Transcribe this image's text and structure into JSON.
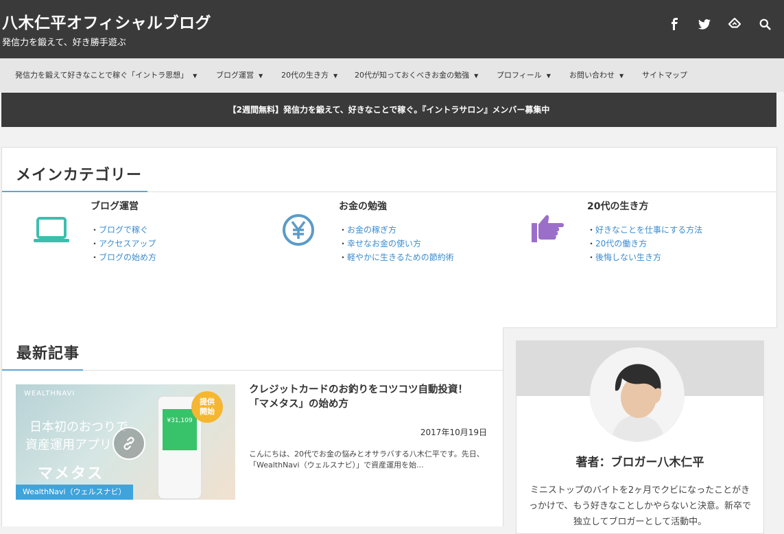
{
  "header": {
    "site_title": "八木仁平オフィシャルブログ",
    "tagline": "発信力を鍛えて、好き勝手遊ぶ",
    "icons": [
      "facebook-icon",
      "twitter-icon",
      "feedly-icon",
      "search-icon"
    ]
  },
  "nav": {
    "items": [
      {
        "label": "発信力を鍛えて好きなことで稼ぐ「イントラ思想」",
        "caret": "▼"
      },
      {
        "label": "ブログ運営",
        "caret": "▼"
      },
      {
        "label": "20代の生き方",
        "caret": "▼"
      },
      {
        "label": "20代が知っておくべきお金の勉強",
        "caret": "▼"
      },
      {
        "label": "プロフィール",
        "caret": "▼"
      },
      {
        "label": "お問い合わせ",
        "caret": "▼"
      },
      {
        "label": "サイトマップ",
        "caret": ""
      }
    ]
  },
  "banner": {
    "text": "【2週間無料】発信力を鍛えて、好きなことで稼ぐ。『イントラサロン』メンバー募集中"
  },
  "categories": {
    "title": "メインカテゴリー",
    "items": [
      {
        "icon": "laptop-icon",
        "color": "#3bbfad",
        "title": "ブログ運営",
        "links": [
          "ブログで稼ぐ",
          "アクセスアップ",
          "ブログの始め方"
        ]
      },
      {
        "icon": "yen-icon",
        "color": "#5b9bc7",
        "title": "お金の勉強",
        "links": [
          "お金の稼ぎ方",
          "幸せなお金の使い方",
          "軽やかに生きるための節約術"
        ]
      },
      {
        "icon": "pointing-hand-icon",
        "color": "#9b6fc9",
        "title": "20代の生き方",
        "links": [
          "好きなことを仕事にする方法",
          "20代の働き方",
          "後悔しない生き方"
        ]
      }
    ],
    "bullet": "・"
  },
  "latest": {
    "title": "最新記事",
    "post": {
      "title": "クレジットカードのお釣りをコツコツ自動投資！「マメタス」の始め方",
      "date": "2017年10月19日",
      "excerpt": "こんにちは、20代でお金の悩みとオサラバする八木仁平です。先日、「WealthNavi（ウェルスナビ）」で資産運用を始...",
      "category_tag": "WealthNavi（ウェルスナビ）",
      "thumbnail": {
        "brand": "WEALTHNAVI",
        "line1": "日本初のおつりで",
        "line2": "資産運用アプリ",
        "logo": "マメタス",
        "badge_line1": "提供",
        "badge_line2": "開始",
        "amount": "¥31,109"
      }
    }
  },
  "profile": {
    "name": "著者：ブロガー八木仁平",
    "bio": "ミニストップのバイトを2ヶ月でクビになったことがきっかけで、もう好きなことしかやらないと決意。新卒で独立してブロガーとして活動中。"
  }
}
